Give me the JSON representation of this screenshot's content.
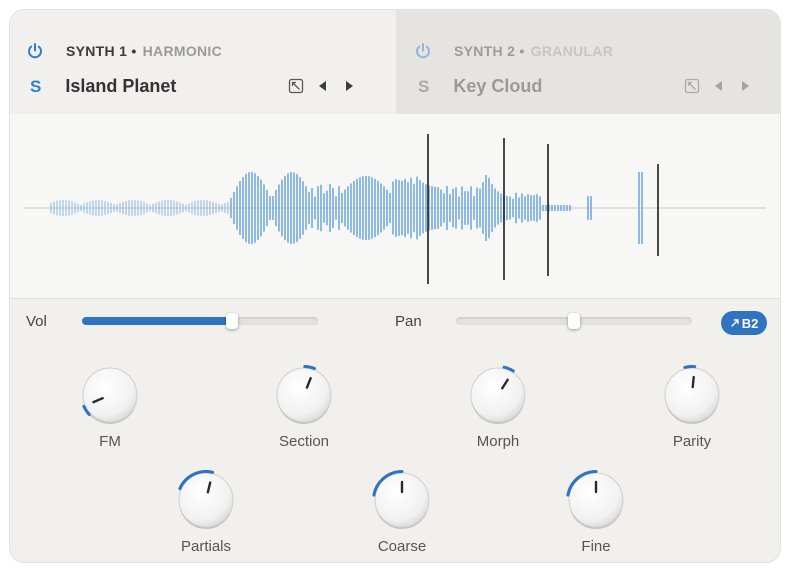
{
  "synth1": {
    "title": "SYNTH 1 •",
    "engine": "HARMONIC",
    "solo": "S",
    "preset": "Island Planet",
    "icons": [
      "power-icon",
      "browser-icon",
      "prev-arrow-icon",
      "next-arrow-icon"
    ]
  },
  "synth2": {
    "title": "SYNTH 2 •",
    "engine": "GRANULAR",
    "solo": "S",
    "preset": "Key Cloud",
    "icons": [
      "power-icon",
      "browser-icon",
      "prev-arrow-icon",
      "next-arrow-icon"
    ]
  },
  "mix": {
    "vol_label": "Vol",
    "vol_value": 0.74,
    "pan_label": "Pan",
    "pan_value": 0.5,
    "badge": "B2"
  },
  "knobs": [
    {
      "label": "FM",
      "value": 0.08
    },
    {
      "label": "Section",
      "value": 0.58
    },
    {
      "label": "Morph",
      "value": 0.62
    },
    {
      "label": "Parity",
      "value": 0.52
    },
    {
      "label": "Partials",
      "value": 0.55
    },
    {
      "label": "Coarse",
      "value": 0.5
    },
    {
      "label": "Fine",
      "value": 0.5
    }
  ],
  "colors": {
    "accent": "#2f74c0",
    "wave": "#7aaee0",
    "panel": "#f1f0ed"
  }
}
